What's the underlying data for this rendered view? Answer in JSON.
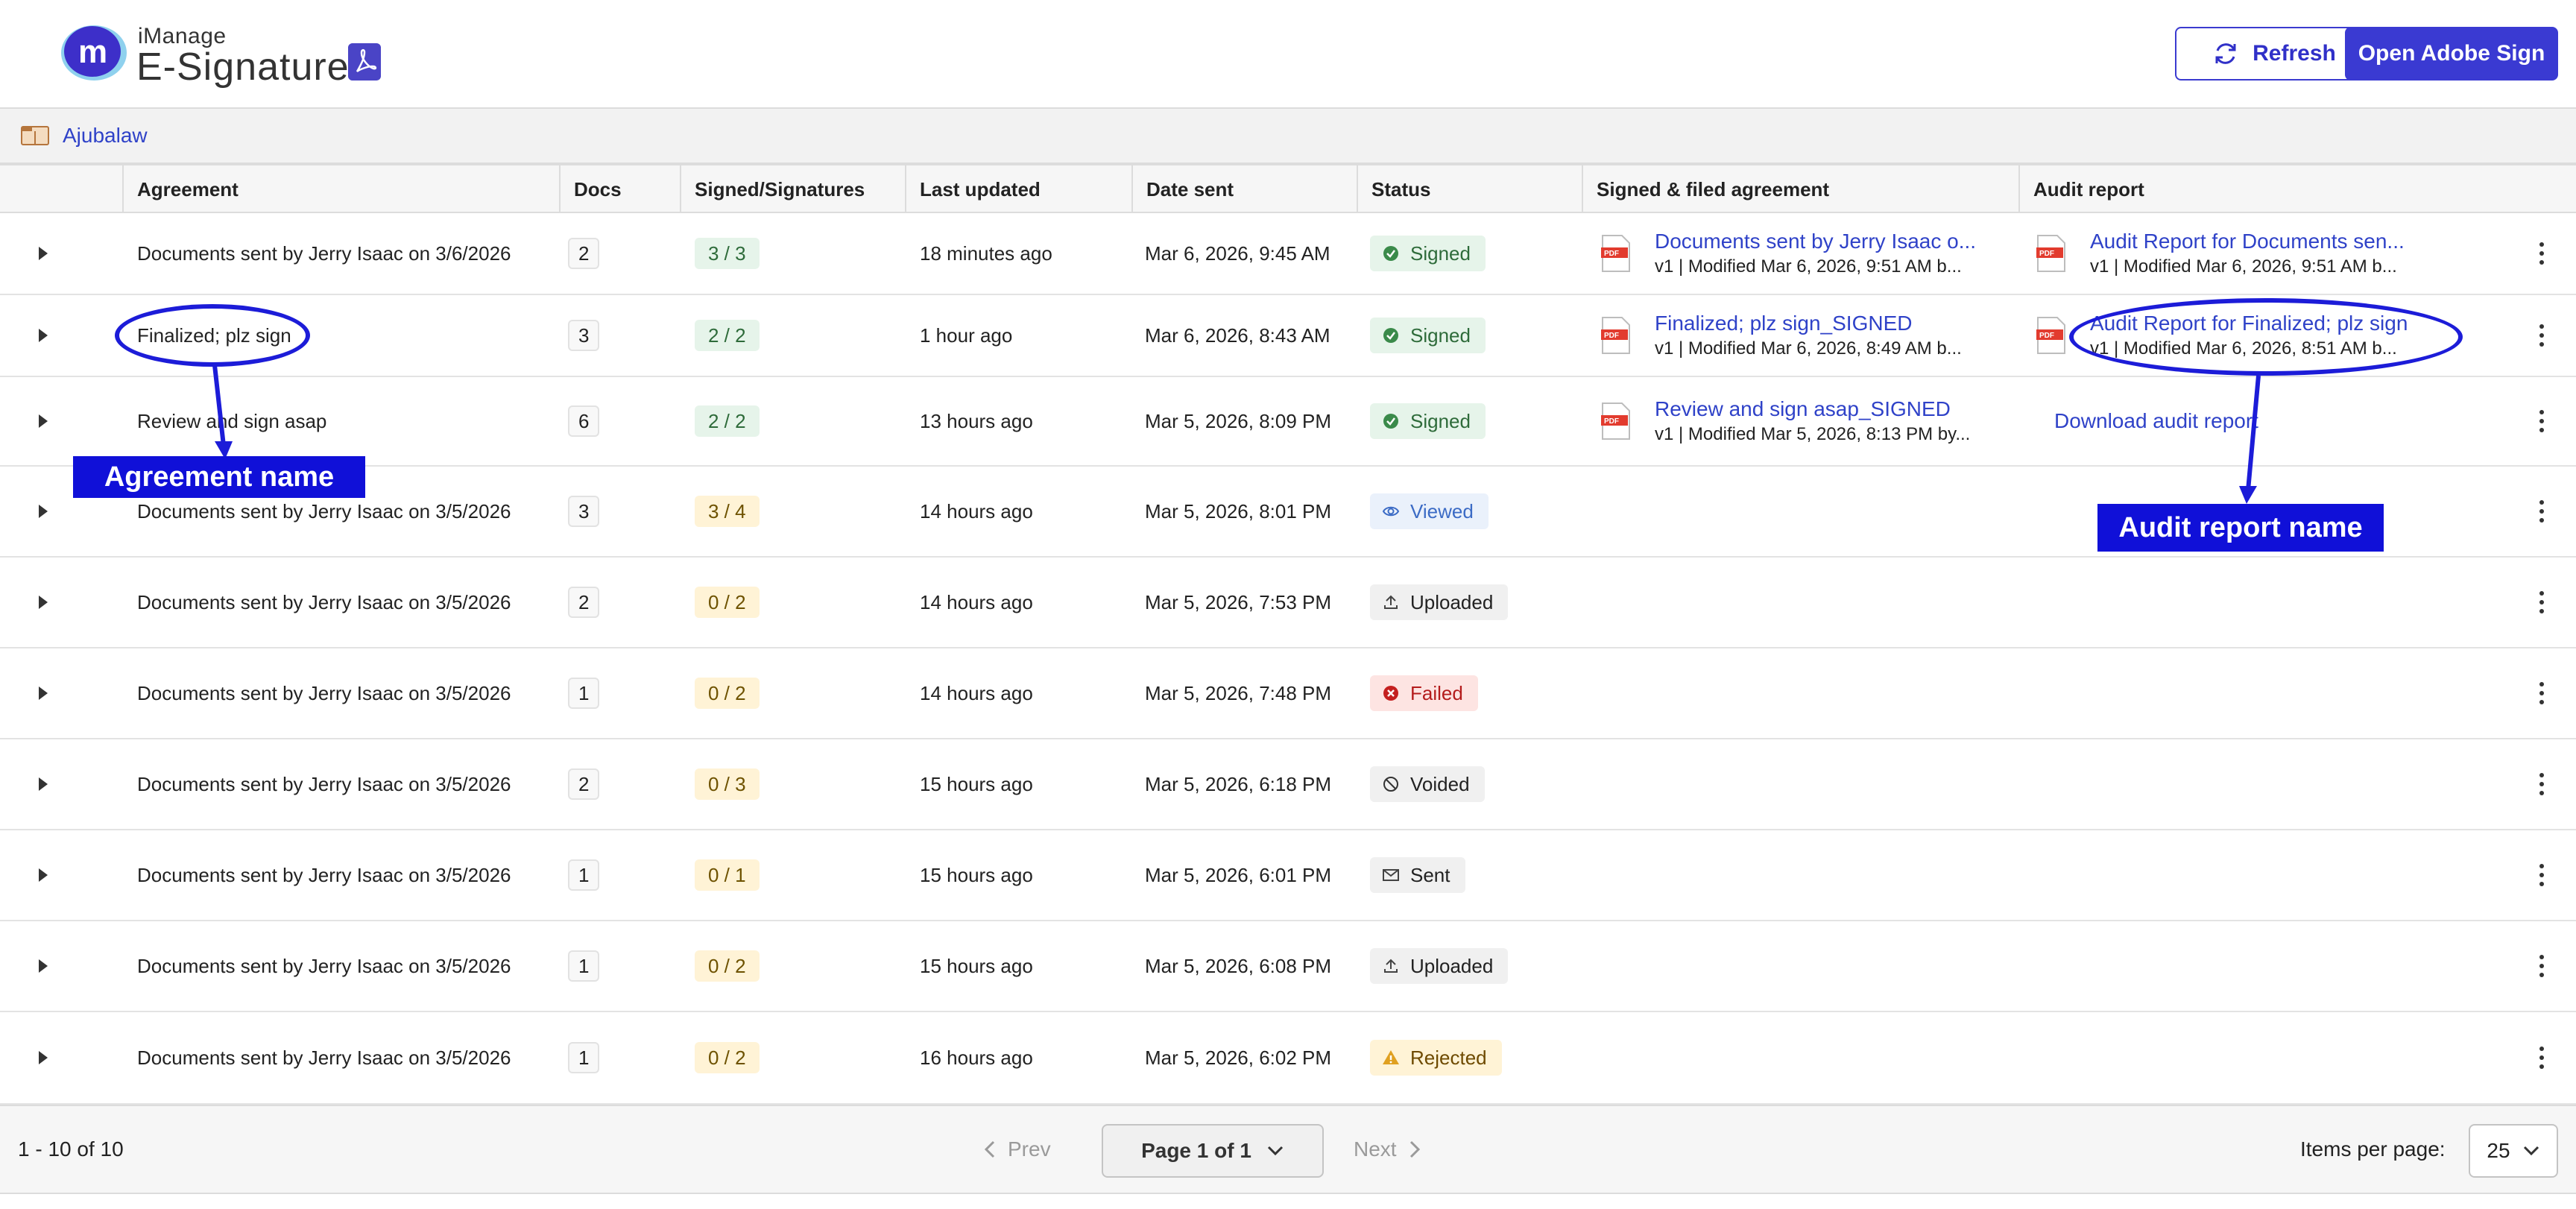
{
  "header": {
    "brand_small": "iManage",
    "brand_big": "E-Signature",
    "refresh_label": "Refresh",
    "open_adobe_label": "Open Adobe Sign"
  },
  "workspace": {
    "name": "Ajubalaw"
  },
  "columns": [
    "Agreement",
    "Docs",
    "Signed/Signatures",
    "Last updated",
    "Date sent",
    "Status",
    "Signed & filed agreement",
    "Audit report"
  ],
  "rows": [
    {
      "agreement": "Documents sent by Jerry Isaac on 3/6/2026",
      "docs": "2",
      "signatures": "3 / 3",
      "sig_tone": "green",
      "last_updated": "18 minutes ago",
      "date_sent": "Mar 6, 2026, 9:45 AM",
      "status": "Signed",
      "status_icon": "check-circle-icon",
      "filed_name": "Documents sent by Jerry Isaac o...",
      "filed_meta": "v1 | Modified Mar 6, 2026, 9:51 AM b...",
      "audit_name": "Audit Report for Documents sen...",
      "audit_meta": "v1 | Modified Mar 6, 2026, 9:51 AM b..."
    },
    {
      "agreement": "Finalized; plz sign",
      "docs": "3",
      "signatures": "2 / 2",
      "sig_tone": "green",
      "last_updated": "1 hour ago",
      "date_sent": "Mar 6, 2026, 8:43 AM",
      "status": "Signed",
      "status_icon": "check-circle-icon",
      "filed_name": "Finalized; plz sign_SIGNED",
      "filed_meta": "v1 | Modified Mar 6, 2026, 8:49 AM b...",
      "audit_name": "Audit Report for Finalized; plz sign",
      "audit_meta": "v1 | Modified Mar 6, 2026, 8:51 AM b..."
    },
    {
      "agreement": "Review and sign asap",
      "docs": "6",
      "signatures": "2 / 2",
      "sig_tone": "green",
      "last_updated": "13 hours ago",
      "date_sent": "Mar 5, 2026, 8:09 PM",
      "status": "Signed",
      "status_icon": "check-circle-icon",
      "filed_name": "Review and sign asap_SIGNED",
      "filed_meta": "v1 | Modified Mar 5, 2026, 8:13 PM by...",
      "audit_download": "Download audit report"
    },
    {
      "agreement": "Documents sent by Jerry Isaac on 3/5/2026",
      "docs": "3",
      "signatures": "3 / 4",
      "sig_tone": "yellow",
      "last_updated": "14 hours ago",
      "date_sent": "Mar 5, 2026, 8:01 PM",
      "status": "Viewed",
      "status_icon": "eye-icon"
    },
    {
      "agreement": "Documents sent by Jerry Isaac on 3/5/2026",
      "docs": "2",
      "signatures": "0 / 2",
      "sig_tone": "yellow",
      "last_updated": "14 hours ago",
      "date_sent": "Mar 5, 2026, 7:53 PM",
      "status": "Uploaded",
      "status_icon": "upload-icon"
    },
    {
      "agreement": "Documents sent by Jerry Isaac on 3/5/2026",
      "docs": "1",
      "signatures": "0 / 2",
      "sig_tone": "yellow",
      "last_updated": "14 hours ago",
      "date_sent": "Mar 5, 2026, 7:48 PM",
      "status": "Failed",
      "status_icon": "x-circle-icon"
    },
    {
      "agreement": "Documents sent by Jerry Isaac on 3/5/2026",
      "docs": "2",
      "signatures": "0 / 3",
      "sig_tone": "yellow",
      "last_updated": "15 hours ago",
      "date_sent": "Mar 5, 2026, 6:18 PM",
      "status": "Voided",
      "status_icon": "ban-icon"
    },
    {
      "agreement": "Documents sent by Jerry Isaac on 3/5/2026",
      "docs": "1",
      "signatures": "0 / 1",
      "sig_tone": "yellow",
      "last_updated": "15 hours ago",
      "date_sent": "Mar 5, 2026, 6:01 PM",
      "status": "Sent",
      "status_icon": "envelope-icon"
    },
    {
      "agreement": "Documents sent by Jerry Isaac on 3/5/2026",
      "docs": "1",
      "signatures": "0 / 2",
      "sig_tone": "yellow",
      "last_updated": "15 hours ago",
      "date_sent": "Mar 5, 2026, 6:08 PM",
      "status": "Uploaded",
      "status_icon": "upload-icon"
    },
    {
      "agreement": "Documents sent by Jerry Isaac on 3/5/2026",
      "docs": "1",
      "signatures": "0 / 2",
      "sig_tone": "yellow",
      "last_updated": "16 hours ago",
      "date_sent": "Mar 5, 2026, 6:02 PM",
      "status": "Rejected",
      "status_icon": "warning-icon"
    }
  ],
  "annotations": {
    "agreement_label": "Agreement name",
    "audit_label": "Audit report name"
  },
  "footer": {
    "range": "1 - 10 of 10",
    "prev": "Prev",
    "page": "Page 1 of 1",
    "next": "Next",
    "items_per_page_label": "Items per page:",
    "items_per_page_value": "25"
  },
  "colors": {
    "accent": "#3a3ad2",
    "link": "#2f42c8",
    "annotation": "#1010d8"
  }
}
